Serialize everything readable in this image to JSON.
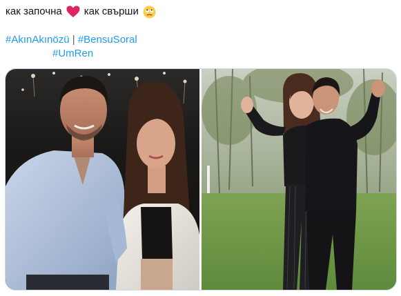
{
  "tweet": {
    "text_start": "как започна",
    "text_end": "как свърши",
    "heart_emoji": "heart-emoji",
    "face_emoji": "face-with-rolling-eyes-emoji",
    "hashtags": [
      {
        "label": "#AkınAkınözü"
      },
      {
        "label": "#BensuSoral"
      },
      {
        "label": "#UmRen"
      }
    ],
    "separator": "|"
  },
  "colors": {
    "link": "#1d9bf0",
    "text": "#0f1419",
    "heart": "#e0245e",
    "emoji_face": "#ffcc4d",
    "border": "#cfd9de"
  },
  "media": {
    "photos": [
      {
        "name": "photo-night-event"
      },
      {
        "name": "photo-outdoor-waving"
      }
    ]
  }
}
